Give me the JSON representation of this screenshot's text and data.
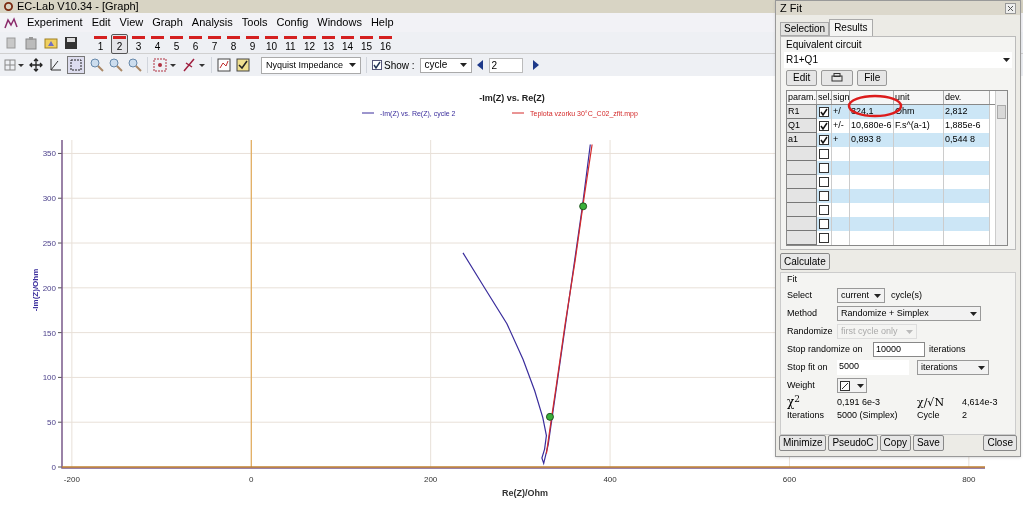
{
  "window": {
    "title": "EC-Lab V10.34 - [Graph]"
  },
  "menu": [
    "Experiment",
    "Edit",
    "View",
    "Graph",
    "Analysis",
    "Tools",
    "Config",
    "Windows",
    "Help"
  ],
  "traces": [
    {
      "label": "1",
      "selected": false
    },
    {
      "label": "2",
      "selected": true
    },
    {
      "label": "3",
      "selected": false
    },
    {
      "label": "4",
      "selected": false
    },
    {
      "label": "5",
      "selected": false
    },
    {
      "label": "6",
      "selected": false
    },
    {
      "label": "7",
      "selected": false
    },
    {
      "label": "8",
      "selected": false
    },
    {
      "label": "9",
      "selected": false
    },
    {
      "label": "10",
      "selected": false
    },
    {
      "label": "11",
      "selected": false
    },
    {
      "label": "12",
      "selected": false
    },
    {
      "label": "13",
      "selected": false
    },
    {
      "label": "14",
      "selected": false
    },
    {
      "label": "15",
      "selected": false
    },
    {
      "label": "16",
      "selected": false
    }
  ],
  "toolbar": {
    "plot_type": "Nyquist Impedance",
    "show": {
      "label": "Show :",
      "checked": true
    },
    "show_mode": "cycle",
    "cycle": "2"
  },
  "graph": {
    "chart_data": {
      "type": "line",
      "title": "-Im(Z) vs. Re(Z)",
      "xlabel": "Re(Z)/Ohm",
      "ylabel": "-Im(Z)/Ohm",
      "xlim": [
        -211,
        818
      ],
      "ylim": [
        0,
        365
      ],
      "xticks": [
        -200,
        0,
        200,
        400,
        600,
        800
      ],
      "yticks": [
        0,
        50,
        100,
        150,
        200,
        250,
        300,
        350
      ],
      "series": [
        {
          "name": "-Im(Z) vs. Re(Z), cycle 2",
          "color": "#3a2d9c",
          "x": [
            236,
            260,
            285,
            303,
            316,
            325,
            329,
            327,
            324,
            326,
            331,
            339,
            349,
            359,
            369,
            378
          ],
          "values": [
            239,
            200,
            160,
            120,
            85,
            55,
            35,
            20,
            10,
            4,
            25,
            80,
            150,
            220,
            290,
            360
          ]
        },
        {
          "name": "Teplota vzorku  30°C_C02_zfit.mpp",
          "color": "#d42a2a",
          "x": [
            329,
            334,
            340,
            350,
            361,
            371,
            380
          ],
          "values": [
            15,
            50,
            90,
            160,
            230,
            300,
            360
          ]
        },
        {
          "type": "scatter",
          "color": "#3ab03a",
          "x": [
            370,
            333
          ],
          "values": [
            291,
            56
          ]
        }
      ],
      "grid": true,
      "legend": true,
      "ref_lines": [
        {
          "axis": "x",
          "value": 0,
          "color": "#e0a040"
        }
      ]
    }
  },
  "zfit": {
    "title": "Z Fit",
    "tabs": [
      {
        "label": "Selection",
        "selected": false
      },
      {
        "label": "Results",
        "selected": true
      }
    ],
    "circuit_label": "Equivalent circuit",
    "circuit": "R1+Q1",
    "buttons": [
      {
        "kind": "text",
        "label": "Edit"
      },
      {
        "kind": "icon"
      },
      {
        "kind": "text",
        "label": "File"
      }
    ],
    "table": {
      "columns": [
        {
          "label": "param."
        },
        {
          "label": "sel."
        },
        {
          "label": "sign"
        },
        {},
        {
          "label": "unit"
        },
        {
          "label": "dev."
        }
      ],
      "rows": [
        {
          "param": "R1",
          "checked": true,
          "sign": "+/",
          "value": "324,1",
          "unit": "Ohm",
          "dev": "2,812"
        },
        {
          "param": "Q1",
          "checked": true,
          "sign": "+/-",
          "value": "10,680e-6",
          "unit": "F.s^(a-1)",
          "dev": "1,885e-6"
        },
        {
          "param": "a1",
          "checked": true,
          "sign": "+",
          "value": "0,893 8",
          "dev": "0,544 8"
        },
        {
          "checked": false
        },
        {
          "checked": false
        },
        {
          "checked": false
        },
        {
          "checked": false
        },
        {
          "checked": false
        },
        {
          "checked": false
        },
        {
          "checked": false
        }
      ]
    },
    "calculate": "Calculate",
    "fit": {
      "label": "Fit",
      "select": {
        "label": "Select",
        "value": "current",
        "suffix": "cycle(s)"
      },
      "method": {
        "label": "Method",
        "value": "Randomize + Simplex"
      },
      "randomize": {
        "label": "Randomize",
        "value": "first cycle only",
        "disabled": true
      },
      "stop_randomize": {
        "label": "Stop randomize on",
        "value": "10000",
        "suffix": "iterations"
      },
      "stop_fit": {
        "label": "Stop fit on",
        "value": "5000",
        "unit": "iterations"
      },
      "weight": {
        "label": "Weight"
      },
      "chi2": {
        "label": "χ$^{2}$",
        "value": "0,191 6e-3"
      },
      "chi_n": {
        "label": "χ/√N",
        "value": "4,614e-3"
      },
      "iterations": {
        "label": "Iterations",
        "value": "5000 (Simplex)"
      },
      "cycle": {
        "label": "Cycle",
        "value": "2"
      }
    },
    "footer": [
      "Minimize",
      "PseudoC",
      "Copy",
      "Save",
      "Close"
    ]
  }
}
